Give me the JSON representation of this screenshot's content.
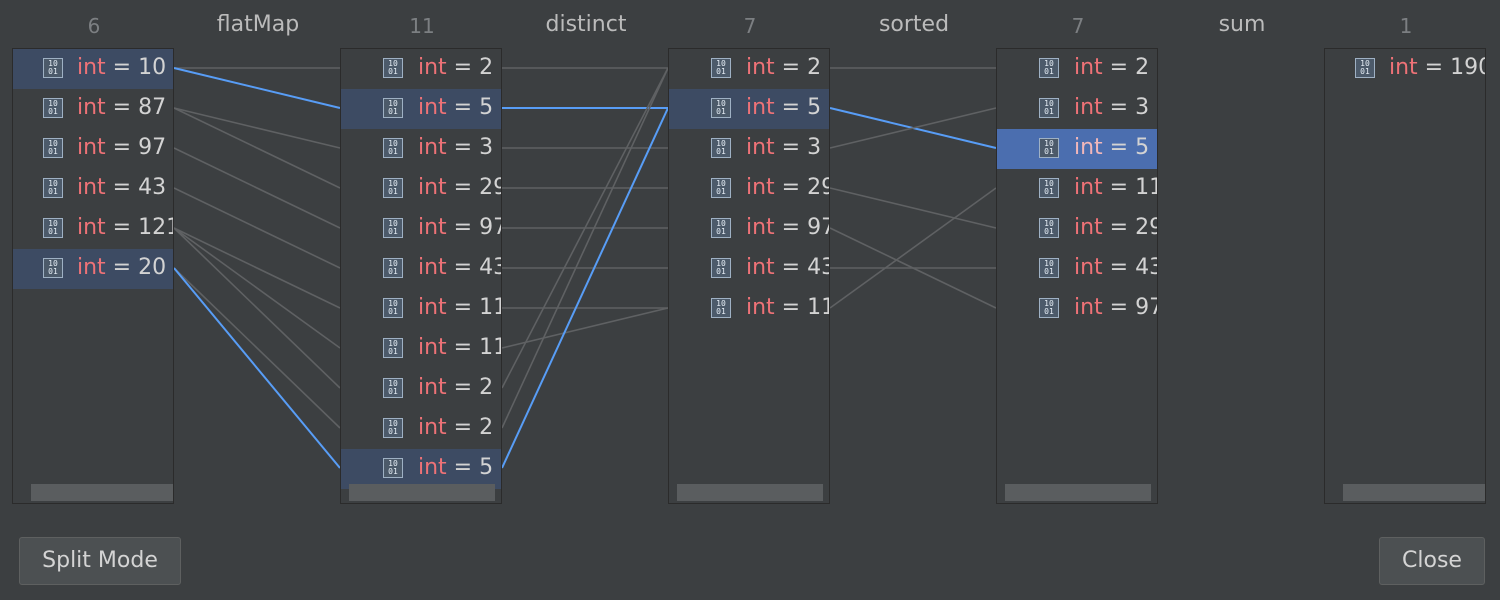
{
  "columns": [
    {
      "count": "6",
      "rows": [
        {
          "type": "int",
          "value": "10",
          "state": "sel"
        },
        {
          "type": "int",
          "value": "87",
          "state": ""
        },
        {
          "type": "int",
          "value": "97",
          "state": ""
        },
        {
          "type": "int",
          "value": "43",
          "state": ""
        },
        {
          "type": "int",
          "value": "121",
          "state": ""
        },
        {
          "type": "int",
          "value": "20",
          "state": "sel"
        }
      ]
    },
    {
      "count": "11",
      "rows": [
        {
          "type": "int",
          "value": "2",
          "state": ""
        },
        {
          "type": "int",
          "value": "5",
          "state": "sel"
        },
        {
          "type": "int",
          "value": "3",
          "state": ""
        },
        {
          "type": "int",
          "value": "29",
          "state": ""
        },
        {
          "type": "int",
          "value": "97",
          "state": ""
        },
        {
          "type": "int",
          "value": "43",
          "state": ""
        },
        {
          "type": "int",
          "value": "11",
          "state": ""
        },
        {
          "type": "int",
          "value": "11",
          "state": ""
        },
        {
          "type": "int",
          "value": "2",
          "state": ""
        },
        {
          "type": "int",
          "value": "2",
          "state": ""
        },
        {
          "type": "int",
          "value": "5",
          "state": "sel"
        }
      ]
    },
    {
      "count": "7",
      "rows": [
        {
          "type": "int",
          "value": "2",
          "state": ""
        },
        {
          "type": "int",
          "value": "5",
          "state": "sel"
        },
        {
          "type": "int",
          "value": "3",
          "state": ""
        },
        {
          "type": "int",
          "value": "29",
          "state": ""
        },
        {
          "type": "int",
          "value": "97",
          "state": ""
        },
        {
          "type": "int",
          "value": "43",
          "state": ""
        },
        {
          "type": "int",
          "value": "11",
          "state": ""
        }
      ]
    },
    {
      "count": "7",
      "rows": [
        {
          "type": "int",
          "value": "2",
          "state": ""
        },
        {
          "type": "int",
          "value": "3",
          "state": ""
        },
        {
          "type": "int",
          "value": "5",
          "state": "cur"
        },
        {
          "type": "int",
          "value": "11",
          "state": ""
        },
        {
          "type": "int",
          "value": "29",
          "state": ""
        },
        {
          "type": "int",
          "value": "43",
          "state": ""
        },
        {
          "type": "int",
          "value": "97",
          "state": ""
        }
      ]
    },
    {
      "count": "1",
      "rows": [
        {
          "type": "int",
          "value": "190",
          "state": ""
        }
      ]
    }
  ],
  "operations": [
    "flatMap",
    "distinct",
    "sorted",
    "sum"
  ],
  "links": [
    {
      "from": [
        0,
        0
      ],
      "to": [
        [
          1,
          0
        ],
        [
          1,
          1
        ]
      ],
      "highlight": [
        1
      ]
    },
    {
      "from": [
        0,
        1
      ],
      "to": [
        [
          1,
          2
        ],
        [
          1,
          3
        ]
      ]
    },
    {
      "from": [
        0,
        2
      ],
      "to": [
        [
          1,
          4
        ]
      ]
    },
    {
      "from": [
        0,
        3
      ],
      "to": [
        [
          1,
          5
        ]
      ]
    },
    {
      "from": [
        0,
        4
      ],
      "to": [
        [
          1,
          6
        ],
        [
          1,
          7
        ],
        [
          1,
          8
        ]
      ]
    },
    {
      "from": [
        0,
        5
      ],
      "to": [
        [
          1,
          9
        ],
        [
          1,
          10
        ]
      ],
      "highlight": [
        10
      ]
    }
  ],
  "links2": [
    [
      0,
      0
    ],
    [
      1,
      1
    ],
    [
      2,
      2
    ],
    [
      3,
      3
    ],
    [
      4,
      4
    ],
    [
      5,
      5
    ],
    [
      6,
      6
    ],
    [
      7,
      6
    ],
    [
      8,
      0
    ],
    [
      9,
      0
    ],
    [
      10,
      1
    ]
  ],
  "links2_highlight": [
    1,
    10
  ],
  "links3": [
    [
      0,
      0
    ],
    [
      1,
      2
    ],
    [
      2,
      1
    ],
    [
      3,
      4
    ],
    [
      4,
      6
    ],
    [
      5,
      5
    ],
    [
      6,
      3
    ]
  ],
  "links3_highlight": [
    1
  ],
  "buttons": {
    "split_mode": "Split Mode",
    "close": "Close"
  },
  "colors": {
    "background": "#3c3f41",
    "selected_row": "#3d4b63",
    "current_row": "#4b6eaf",
    "highlight_link": "#589df6",
    "link": "#5f6163",
    "keyword": "#ee7277"
  },
  "icon": "binary-value-icon"
}
